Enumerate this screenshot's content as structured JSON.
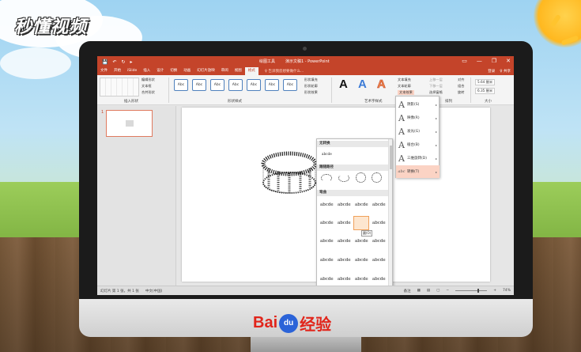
{
  "brand_logo": "秒懂视频",
  "baidu": {
    "bai": "Bai",
    "du": "du",
    "jingyan": "经验"
  },
  "titlebar": {
    "context_tab": "绘图工具",
    "document_title": "演示文稿1 - PowerPoint",
    "quick_access": [
      "💾",
      "↶",
      "↻",
      "▸"
    ],
    "window_controls": [
      "▭",
      "—",
      "❐",
      "✕"
    ]
  },
  "tabs": [
    "文件",
    "开始",
    "iSlide",
    "插入",
    "设计",
    "切换",
    "动画",
    "幻灯片放映",
    "审阅",
    "视图",
    "格式"
  ],
  "active_tab": "格式",
  "search_placeholder": "♀ 告诉我您想要做什么...",
  "account": {
    "login": "登录",
    "share": "♀ 共享"
  },
  "ribbon": {
    "insert_shapes": {
      "label": "插入形状",
      "edit_shape": "编辑形状",
      "textbox": "文本框",
      "merge_shapes": "合并形状"
    },
    "shape_styles": {
      "label": "形状样式",
      "style_text": "Abc",
      "fill": "形状填充",
      "outline": "形状轮廓",
      "effects": "形状效果"
    },
    "wordart_styles": {
      "label": "艺术字样式",
      "glyph": "A",
      "text_fill": "文本填充",
      "text_outline": "文本轮廓",
      "text_effects": "文本效果"
    },
    "arrange": {
      "label": "排列",
      "bring_forward": "上移一层",
      "send_backward": "下移一层",
      "selection_pane": "选择窗格",
      "align": "对齐",
      "group": "组合",
      "rotate": "旋转"
    },
    "size": {
      "label": "大小",
      "height": "5.64 厘米",
      "width": "6.35 厘米"
    }
  },
  "slide_thumbnail": {
    "number": "1"
  },
  "status": {
    "slide_info": "幻灯片 第 1 张，共 1 张",
    "language": "中文(中国)",
    "notes": "备注",
    "zoom": "74%",
    "zoom_minus": "−",
    "zoom_plus": "+"
  },
  "text_effects_menu": [
    {
      "label": "阴影(S)",
      "glyph": "A"
    },
    {
      "label": "映像(R)",
      "glyph": "A"
    },
    {
      "label": "发光(G)",
      "glyph": "A"
    },
    {
      "label": "棱台(B)",
      "glyph": "A"
    },
    {
      "label": "三维旋转(D)",
      "glyph": "A"
    },
    {
      "label": "转换(T)",
      "glyph": "abc"
    }
  ],
  "gallery": {
    "section_no_transform": "无转换",
    "no_transform_sample": "abcde",
    "section_follow_path": "跟随路径",
    "section_warp": "弯曲",
    "warp_sample": "abcde",
    "hover_tooltip": "圆(O)"
  }
}
